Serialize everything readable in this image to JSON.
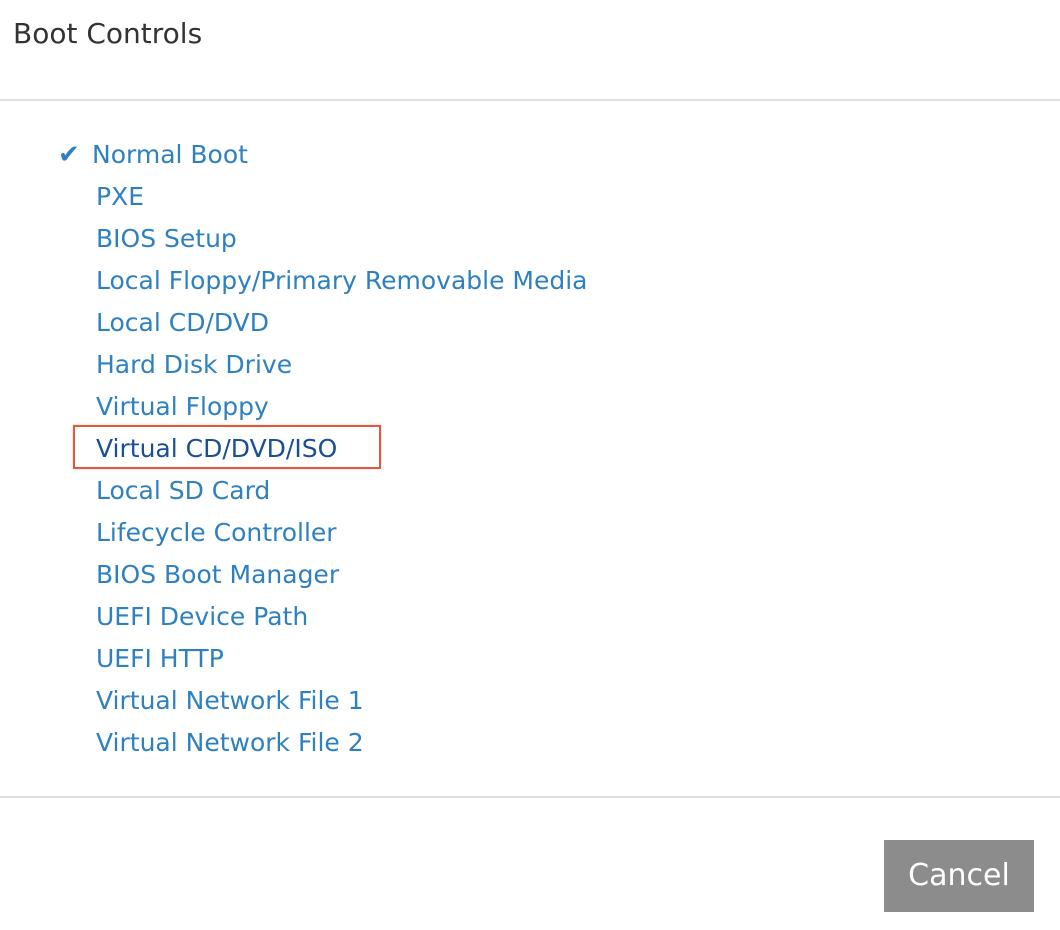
{
  "dialog": {
    "title": "Boot Controls",
    "options": [
      {
        "label": "Normal Boot",
        "selected": true
      },
      {
        "label": "PXE"
      },
      {
        "label": "BIOS Setup"
      },
      {
        "label": "Local Floppy/Primary Removable Media"
      },
      {
        "label": "Local CD/DVD"
      },
      {
        "label": "Hard Disk Drive"
      },
      {
        "label": "Virtual Floppy"
      },
      {
        "label": "Virtual CD/DVD/ISO",
        "highlighted": true
      },
      {
        "label": "Local SD Card"
      },
      {
        "label": "Lifecycle Controller"
      },
      {
        "label": "BIOS Boot Manager"
      },
      {
        "label": "UEFI Device Path"
      },
      {
        "label": "UEFI HTTP"
      },
      {
        "label": "Virtual Network File 1"
      },
      {
        "label": "Virtual Network File 2"
      }
    ],
    "check_icon": "checkmark-icon",
    "check_glyph": "✔",
    "cancel_label": "Cancel"
  },
  "colors": {
    "link": "#2e80bf",
    "highlight_border": "#e05a3e",
    "button_bg": "#8c8c8c",
    "divider": "#dedede"
  }
}
